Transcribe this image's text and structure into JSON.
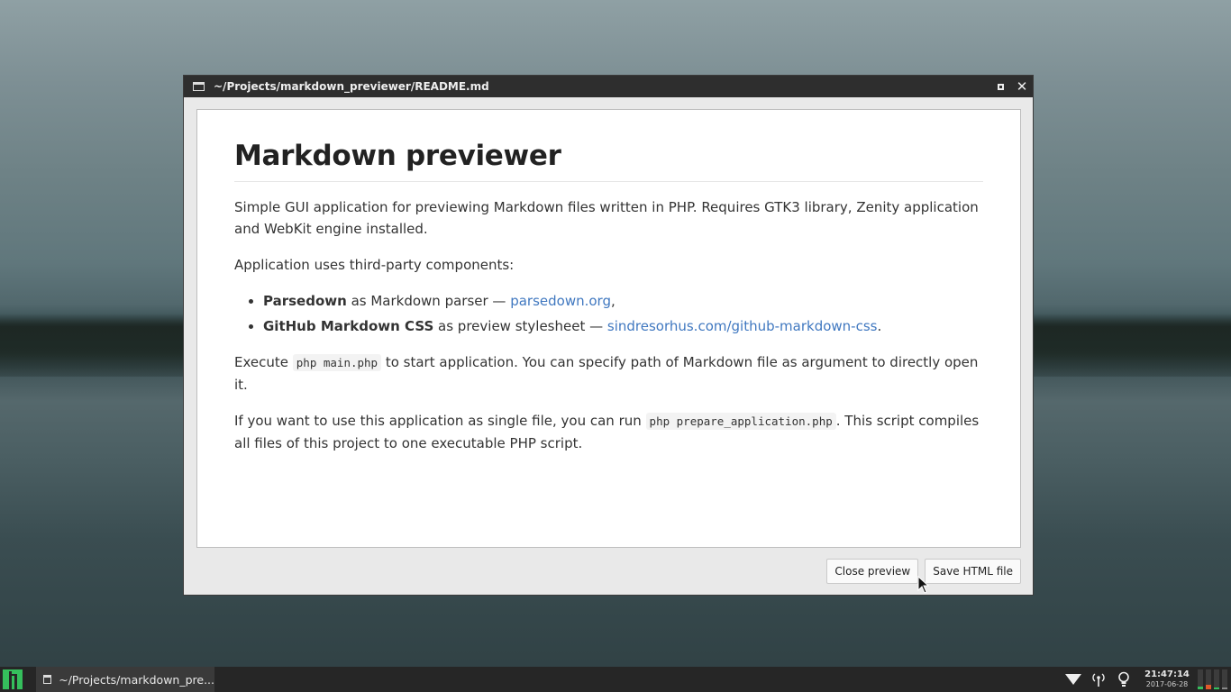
{
  "window": {
    "title": "~/Projects/markdown_previewer/README.md"
  },
  "readme": {
    "heading": "Markdown previewer",
    "intro": "Simple GUI application for previewing Markdown files written in PHP. Requires GTK3 library, Zenity application and WebKit engine installed.",
    "components_intro": "Application uses third-party components:",
    "components": [
      {
        "name": "Parsedown",
        "desc": " as Markdown parser — ",
        "link": "parsedown.org",
        "tail": ","
      },
      {
        "name": "GitHub Markdown CSS",
        "desc": " as preview stylesheet — ",
        "link": "sindresorhus.com/github-markdown-css",
        "tail": "."
      }
    ],
    "execute": {
      "pre": "Execute ",
      "code": "php main.php",
      "post": " to start application. You can specify path of Markdown file as argument to directly open it."
    },
    "single_file": {
      "pre": "If you want to use this application as single file, you can run ",
      "code": "php prepare_application.php",
      "post": ". This script compiles all files of this project to one executable PHP script."
    }
  },
  "buttons": {
    "close_preview": "Close preview",
    "save_html": "Save HTML file"
  },
  "taskbar": {
    "task_label": "~/Projects/markdown_pre...",
    "time": "21:47:14",
    "date": "2017-06-28"
  },
  "colors": {
    "link": "#4078c0",
    "titlebar": "#2e2e2e",
    "taskbar": "#262626",
    "manjaro_green": "#35bf5c"
  },
  "icons": [
    "window-icon",
    "maximize-icon",
    "close-icon",
    "manjaro-logo-icon",
    "wifi-icon",
    "antenna-icon",
    "lightbulb-icon",
    "mouse-pointer-icon"
  ]
}
